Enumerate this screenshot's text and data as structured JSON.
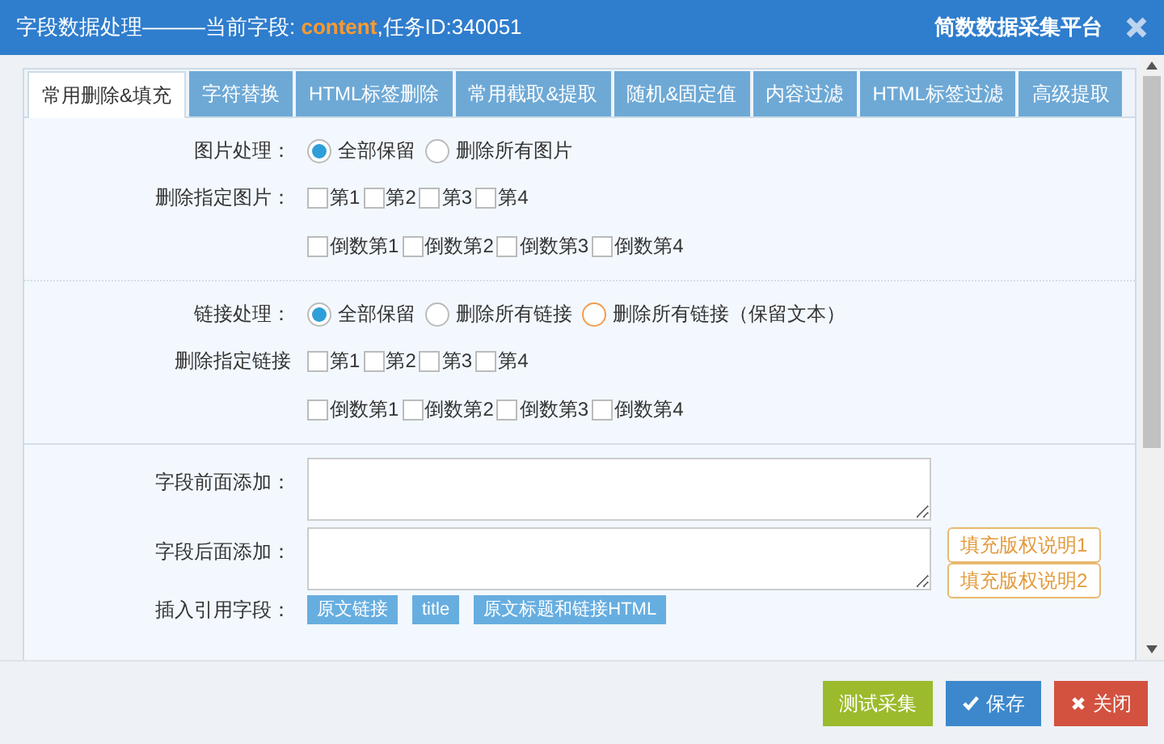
{
  "window": {
    "title_prefix": "字段数据处理———当前字段: ",
    "field": "content",
    "title_suffix": ",任务ID:340051",
    "brand": "简数数据采集平台"
  },
  "tabs": [
    {
      "label": "常用删除&填充",
      "selected": true
    },
    {
      "label": "字符替换",
      "selected": false
    },
    {
      "label": "HTML标签删除",
      "selected": false
    },
    {
      "label": "常用截取&提取",
      "selected": false
    },
    {
      "label": "随机&固定值",
      "selected": false
    },
    {
      "label": "内容过滤",
      "selected": false
    },
    {
      "label": "HTML标签过滤",
      "selected": false
    },
    {
      "label": "高级提取",
      "selected": false
    }
  ],
  "sections": [
    {
      "radio_label": "图片处理：",
      "radios": [
        {
          "label": "全部保留",
          "selected": true,
          "highlighted": false
        },
        {
          "label": "删除所有图片",
          "selected": false,
          "highlighted": false
        }
      ],
      "check_label": "删除指定图片：",
      "checks": [
        [
          {
            "label": "第1",
            "checked": false
          },
          {
            "label": "第2",
            "checked": false
          },
          {
            "label": "第3",
            "checked": false
          },
          {
            "label": "第4",
            "checked": false
          }
        ],
        [
          {
            "label": "倒数第1",
            "checked": false
          },
          {
            "label": "倒数第2",
            "checked": false
          },
          {
            "label": "倒数第3",
            "checked": false
          },
          {
            "label": "倒数第4",
            "checked": false
          }
        ]
      ]
    },
    {
      "radio_label": "链接处理：",
      "radios": [
        {
          "label": "全部保留",
          "selected": true,
          "highlighted": false
        },
        {
          "label": "删除所有链接",
          "selected": false,
          "highlighted": false
        },
        {
          "label": "删除所有链接（保留文本）",
          "selected": false,
          "highlighted": true
        }
      ],
      "check_label": "删除指定链接",
      "checks": [
        [
          {
            "label": "第1",
            "checked": false
          },
          {
            "label": "第2",
            "checked": false
          },
          {
            "label": "第3",
            "checked": false
          },
          {
            "label": "第4",
            "checked": false
          }
        ],
        [
          {
            "label": "倒数第1",
            "checked": false
          },
          {
            "label": "倒数第2",
            "checked": false
          },
          {
            "label": "倒数第3",
            "checked": false
          },
          {
            "label": "倒数第4",
            "checked": false
          }
        ]
      ]
    }
  ],
  "prepend": {
    "label": "字段前面添加："
  },
  "append": {
    "label": "字段后面添加：",
    "buttons": [
      "填充版权说明1",
      "填充版权说明2"
    ]
  },
  "insert": {
    "label": "插入引用字段：",
    "buttons": [
      "原文链接",
      "title",
      "原文标题和链接HTML"
    ]
  },
  "footer": [
    {
      "label": "测试采集",
      "kind": "test"
    },
    {
      "label": "保存",
      "kind": "save"
    },
    {
      "label": "关闭",
      "kind": "close"
    }
  ]
}
